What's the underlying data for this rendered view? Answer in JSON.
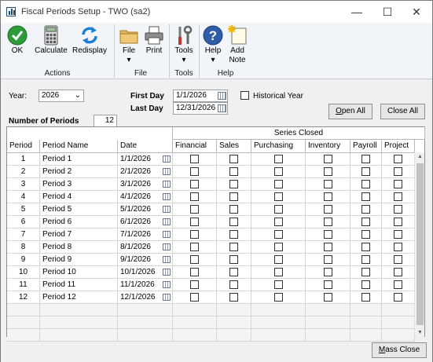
{
  "window": {
    "title": "Fiscal Periods Setup  -  TWO (sa2)",
    "minimize": "—",
    "maximize": "☐",
    "close": "✕"
  },
  "ribbon": {
    "buttons": {
      "ok": "OK",
      "calculate": "Calculate",
      "redisplay": "Redisplay",
      "file": "File",
      "print": "Print",
      "tools": "Tools",
      "help": "Help",
      "add_note_1": "Add",
      "add_note_2": "Note"
    },
    "groups": {
      "actions": "Actions",
      "file": "File",
      "tools": "Tools",
      "help": "Help"
    },
    "dropdown_arrow": "▾"
  },
  "form": {
    "year_label": "Year:",
    "year_value": "2026",
    "first_day_label": "First Day",
    "first_day_value": "1/1/2026",
    "last_day_label": "Last Day",
    "last_day_value": "12/31/2026",
    "historical_label": "Historical Year",
    "num_periods_label": "Number of Periods",
    "num_periods_value": "12",
    "open_all_a": "O",
    "open_all_b": "pen All",
    "close_all": "Close All",
    "mass_close_a": "M",
    "mass_close_b": "ass Close"
  },
  "grid": {
    "series_closed": "Series Closed",
    "columns": [
      "Period",
      "Period Name",
      "Date",
      "Financial",
      "Sales",
      "Purchasing",
      "Inventory",
      "Payroll",
      "Project"
    ],
    "rows": [
      {
        "period": "1",
        "name": "Period 1",
        "date": "1/1/2026"
      },
      {
        "period": "2",
        "name": "Period 2",
        "date": "2/1/2026"
      },
      {
        "period": "3",
        "name": "Period 3",
        "date": "3/1/2026"
      },
      {
        "period": "4",
        "name": "Period 4",
        "date": "4/1/2026"
      },
      {
        "period": "5",
        "name": "Period 5",
        "date": "5/1/2026"
      },
      {
        "period": "6",
        "name": "Period 6",
        "date": "6/1/2026"
      },
      {
        "period": "7",
        "name": "Period 7",
        "date": "7/1/2026"
      },
      {
        "period": "8",
        "name": "Period 8",
        "date": "8/1/2026"
      },
      {
        "period": "9",
        "name": "Period 9",
        "date": "9/1/2026"
      },
      {
        "period": "10",
        "name": "Period 10",
        "date": "10/1/2026"
      },
      {
        "period": "11",
        "name": "Period 11",
        "date": "11/1/2026"
      },
      {
        "period": "12",
        "name": "Period 12",
        "date": "12/1/2026"
      }
    ],
    "scroll_up": "▲",
    "scroll_down": "▼"
  }
}
